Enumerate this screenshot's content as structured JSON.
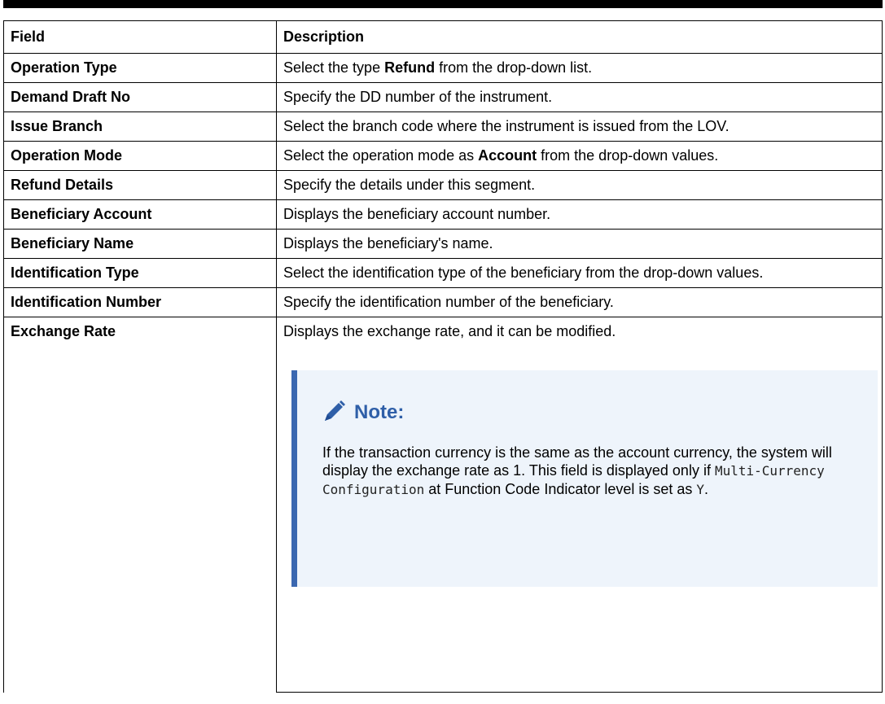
{
  "table": {
    "header": {
      "field": "Field",
      "description": "Description"
    },
    "rows": [
      {
        "field": "Operation Type",
        "pre": "Select the type ",
        "bold": "Refund",
        "post": " from the drop-down list."
      },
      {
        "field": "Demand Draft No",
        "desc": "Specify the DD number of the instrument."
      },
      {
        "field": "Issue Branch",
        "desc": "Select the branch code where the instrument is issued from the LOV."
      },
      {
        "field": "Operation Mode",
        "pre": "Select the operation mode as ",
        "bold": "Account",
        "post": " from the drop-down values."
      },
      {
        "field": "Refund Details",
        "desc": "Specify the details under this segment."
      },
      {
        "field": "Beneficiary Account",
        "desc": "Displays the beneficiary account number."
      },
      {
        "field": "Beneficiary Name",
        "desc": "Displays the beneficiary's name."
      },
      {
        "field": "Identification Type",
        "desc": "Select the identification type of the beneficiary from the drop-down values."
      },
      {
        "field": "Identification Number",
        "desc": "Specify the identification number of the beneficiary."
      },
      {
        "field": "Exchange Rate",
        "desc": "Displays the exchange rate, and it can be modified."
      }
    ]
  },
  "note": {
    "title": "Note:",
    "icon": "pencil-icon",
    "text_1": "If the transaction currency is the same as the account currency, the system will display the exchange rate as 1. This field is displayed only if ",
    "code_1": "Multi-Currency Configuration",
    "text_2": " at Function Code Indicator level is set as ",
    "code_2": "Y",
    "text_3": ".",
    "accent_color": "#3a67b0",
    "background_color": "#eef4fb"
  }
}
